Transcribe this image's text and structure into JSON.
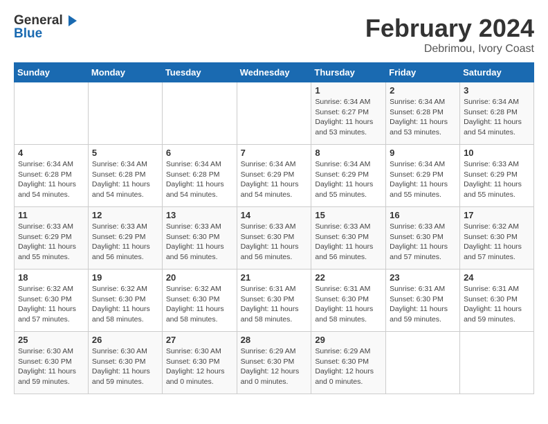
{
  "logo": {
    "general": "General",
    "blue": "Blue"
  },
  "title": "February 2024",
  "subtitle": "Debrimou, Ivory Coast",
  "days_of_week": [
    "Sunday",
    "Monday",
    "Tuesday",
    "Wednesday",
    "Thursday",
    "Friday",
    "Saturday"
  ],
  "weeks": [
    [
      {
        "day": "",
        "detail": ""
      },
      {
        "day": "",
        "detail": ""
      },
      {
        "day": "",
        "detail": ""
      },
      {
        "day": "",
        "detail": ""
      },
      {
        "day": "1",
        "detail": "Sunrise: 6:34 AM\nSunset: 6:27 PM\nDaylight: 11 hours\nand 53 minutes."
      },
      {
        "day": "2",
        "detail": "Sunrise: 6:34 AM\nSunset: 6:28 PM\nDaylight: 11 hours\nand 53 minutes."
      },
      {
        "day": "3",
        "detail": "Sunrise: 6:34 AM\nSunset: 6:28 PM\nDaylight: 11 hours\nand 54 minutes."
      }
    ],
    [
      {
        "day": "4",
        "detail": "Sunrise: 6:34 AM\nSunset: 6:28 PM\nDaylight: 11 hours\nand 54 minutes."
      },
      {
        "day": "5",
        "detail": "Sunrise: 6:34 AM\nSunset: 6:28 PM\nDaylight: 11 hours\nand 54 minutes."
      },
      {
        "day": "6",
        "detail": "Sunrise: 6:34 AM\nSunset: 6:28 PM\nDaylight: 11 hours\nand 54 minutes."
      },
      {
        "day": "7",
        "detail": "Sunrise: 6:34 AM\nSunset: 6:29 PM\nDaylight: 11 hours\nand 54 minutes."
      },
      {
        "day": "8",
        "detail": "Sunrise: 6:34 AM\nSunset: 6:29 PM\nDaylight: 11 hours\nand 55 minutes."
      },
      {
        "day": "9",
        "detail": "Sunrise: 6:34 AM\nSunset: 6:29 PM\nDaylight: 11 hours\nand 55 minutes."
      },
      {
        "day": "10",
        "detail": "Sunrise: 6:33 AM\nSunset: 6:29 PM\nDaylight: 11 hours\nand 55 minutes."
      }
    ],
    [
      {
        "day": "11",
        "detail": "Sunrise: 6:33 AM\nSunset: 6:29 PM\nDaylight: 11 hours\nand 55 minutes."
      },
      {
        "day": "12",
        "detail": "Sunrise: 6:33 AM\nSunset: 6:29 PM\nDaylight: 11 hours\nand 56 minutes."
      },
      {
        "day": "13",
        "detail": "Sunrise: 6:33 AM\nSunset: 6:30 PM\nDaylight: 11 hours\nand 56 minutes."
      },
      {
        "day": "14",
        "detail": "Sunrise: 6:33 AM\nSunset: 6:30 PM\nDaylight: 11 hours\nand 56 minutes."
      },
      {
        "day": "15",
        "detail": "Sunrise: 6:33 AM\nSunset: 6:30 PM\nDaylight: 11 hours\nand 56 minutes."
      },
      {
        "day": "16",
        "detail": "Sunrise: 6:33 AM\nSunset: 6:30 PM\nDaylight: 11 hours\nand 57 minutes."
      },
      {
        "day": "17",
        "detail": "Sunrise: 6:32 AM\nSunset: 6:30 PM\nDaylight: 11 hours\nand 57 minutes."
      }
    ],
    [
      {
        "day": "18",
        "detail": "Sunrise: 6:32 AM\nSunset: 6:30 PM\nDaylight: 11 hours\nand 57 minutes."
      },
      {
        "day": "19",
        "detail": "Sunrise: 6:32 AM\nSunset: 6:30 PM\nDaylight: 11 hours\nand 58 minutes."
      },
      {
        "day": "20",
        "detail": "Sunrise: 6:32 AM\nSunset: 6:30 PM\nDaylight: 11 hours\nand 58 minutes."
      },
      {
        "day": "21",
        "detail": "Sunrise: 6:31 AM\nSunset: 6:30 PM\nDaylight: 11 hours\nand 58 minutes."
      },
      {
        "day": "22",
        "detail": "Sunrise: 6:31 AM\nSunset: 6:30 PM\nDaylight: 11 hours\nand 58 minutes."
      },
      {
        "day": "23",
        "detail": "Sunrise: 6:31 AM\nSunset: 6:30 PM\nDaylight: 11 hours\nand 59 minutes."
      },
      {
        "day": "24",
        "detail": "Sunrise: 6:31 AM\nSunset: 6:30 PM\nDaylight: 11 hours\nand 59 minutes."
      }
    ],
    [
      {
        "day": "25",
        "detail": "Sunrise: 6:30 AM\nSunset: 6:30 PM\nDaylight: 11 hours\nand 59 minutes."
      },
      {
        "day": "26",
        "detail": "Sunrise: 6:30 AM\nSunset: 6:30 PM\nDaylight: 11 hours\nand 59 minutes."
      },
      {
        "day": "27",
        "detail": "Sunrise: 6:30 AM\nSunset: 6:30 PM\nDaylight: 12 hours\nand 0 minutes."
      },
      {
        "day": "28",
        "detail": "Sunrise: 6:29 AM\nSunset: 6:30 PM\nDaylight: 12 hours\nand 0 minutes."
      },
      {
        "day": "29",
        "detail": "Sunrise: 6:29 AM\nSunset: 6:30 PM\nDaylight: 12 hours\nand 0 minutes."
      },
      {
        "day": "",
        "detail": ""
      },
      {
        "day": "",
        "detail": ""
      }
    ]
  ]
}
